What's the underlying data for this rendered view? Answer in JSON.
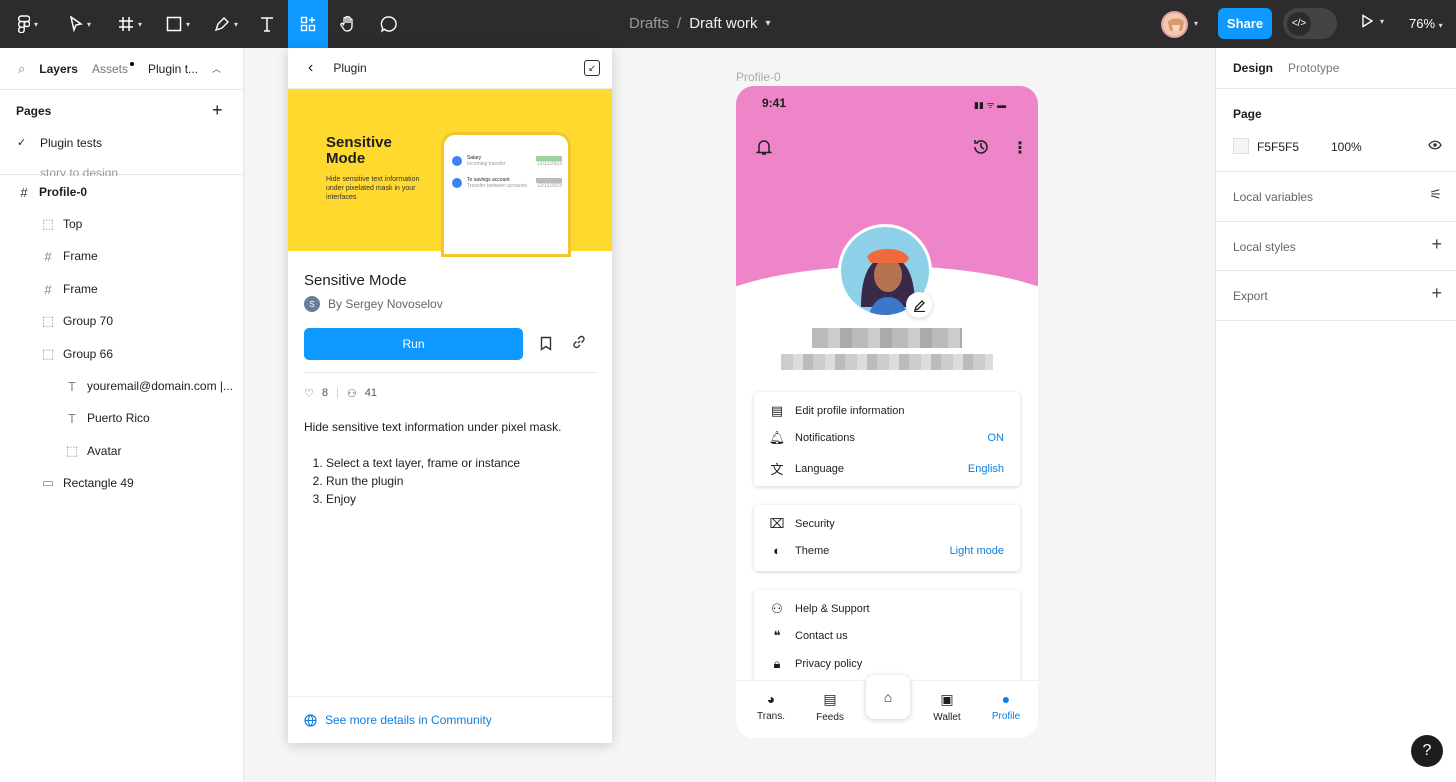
{
  "topbar": {
    "breadcrumb_parent": "Drafts",
    "breadcrumb_sep": "/",
    "file_title": "Draft work",
    "share_label": "Share",
    "zoom": "76%",
    "dev_mode_icon": "</>",
    "accent": "#0d99ff"
  },
  "left": {
    "tabs": [
      "Layers",
      "Assets",
      "Plugin t..."
    ],
    "pages_heading": "Pages",
    "pages": [
      "Plugin tests",
      "story to design"
    ],
    "layers": [
      {
        "label": "Profile-0",
        "icon": "frame-icon"
      },
      {
        "label": "Top",
        "icon": "group-icon"
      },
      {
        "label": "Frame",
        "icon": "frame-icon"
      },
      {
        "label": "Frame",
        "icon": "frame-icon"
      },
      {
        "label": "Group 70",
        "icon": "group-icon"
      },
      {
        "label": "Group 66",
        "icon": "group-icon"
      },
      {
        "label": "youremail@domain.com |...",
        "icon": "text-icon"
      },
      {
        "label": "Puerto Rico",
        "icon": "text-icon"
      },
      {
        "label": "Avatar",
        "icon": "group-icon"
      },
      {
        "label": "Rectangle 49",
        "icon": "rectangle-icon"
      }
    ]
  },
  "plugin": {
    "header": "Plugin",
    "banner_title": "Sensitive Mode",
    "banner_desc": "Hide sensitive text information under pixelated mask in your interfaces",
    "mock_rows": [
      {
        "title": "Salary",
        "sub": "Incoming transfer",
        "date": "12/12/2023"
      },
      {
        "title": "To savings account",
        "sub": "Transfer between accounts",
        "date": "12/12/2023"
      }
    ],
    "name": "Sensitive Mode",
    "author_initial": "S",
    "author": "By Sergey Novoselov",
    "run_label": "Run",
    "likes": "8",
    "users": "41",
    "description": "Hide sensitive text information under pixel mask.",
    "steps": [
      "Select a text layer, frame or instance",
      "Run the plugin",
      "Enjoy"
    ],
    "footer_link": "See more details in Community"
  },
  "canvas": {
    "frame_label": "Profile-0",
    "time": "9:41",
    "brand_pink": "#ef85c9",
    "card1": [
      {
        "label": "Edit profile information",
        "value": "",
        "icon": "id-card-icon"
      },
      {
        "label": "Notifications",
        "value": "ON",
        "icon": "bell-icon"
      },
      {
        "label": "Language",
        "value": "English",
        "icon": "translate-icon"
      }
    ],
    "card2": [
      {
        "label": "Security",
        "value": "",
        "icon": "security-icon"
      },
      {
        "label": "Theme",
        "value": "Light mode",
        "icon": "theme-icon"
      }
    ],
    "card3": [
      {
        "label": "Help & Support",
        "value": "",
        "icon": "help-icon"
      },
      {
        "label": "Contact us",
        "value": "",
        "icon": "chat-icon"
      },
      {
        "label": "Privacy policy",
        "value": "",
        "icon": "lock-icon"
      }
    ],
    "nav": [
      "Trans.",
      "Feeds",
      "",
      "Wallet",
      "Profile"
    ]
  },
  "right": {
    "tabs": [
      "Design",
      "Prototype"
    ],
    "page_heading": "Page",
    "page_color": "F5F5F5",
    "page_opacity": "100%",
    "sections": [
      "Local variables",
      "Local styles",
      "Export"
    ]
  },
  "help_label": "?"
}
